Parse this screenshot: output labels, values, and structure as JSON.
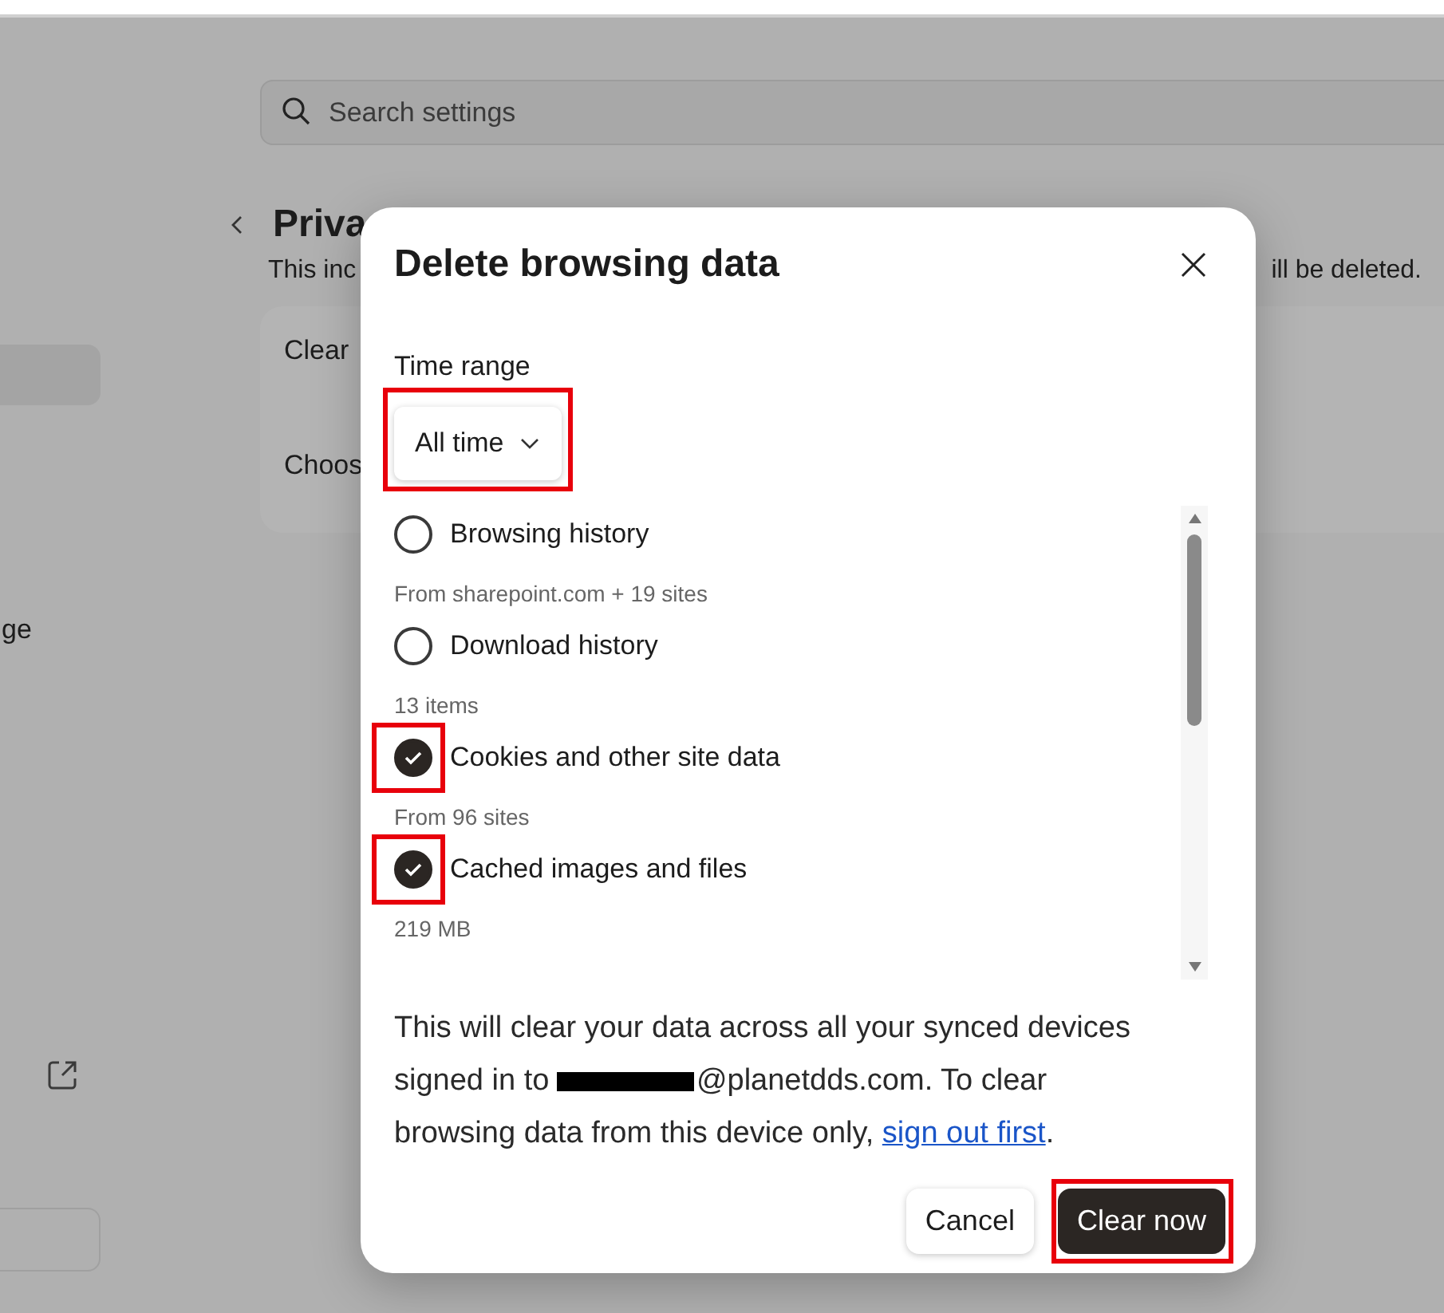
{
  "settings_page": {
    "search": {
      "placeholder": "Search settings"
    },
    "title": "Priva",
    "description": "This inc",
    "description_tail": "ill be deleted.",
    "card_rows": [
      "Clear",
      "Choos"
    ],
    "sidebar_items": [
      {
        "selected": true
      },
      {
        "label": "ge",
        "selected": false
      }
    ]
  },
  "dialog": {
    "title": "Delete browsing data",
    "time_range": {
      "label": "Time range",
      "value": "All time",
      "highlighted": true
    },
    "options": [
      {
        "label": "Browsing history",
        "detail": "From sharepoint.com + 19 sites",
        "checked": false,
        "highlighted": false
      },
      {
        "label": "Download history",
        "detail": "13 items",
        "checked": false,
        "highlighted": false
      },
      {
        "label": "Cookies and other site data",
        "detail": "From 96 sites",
        "checked": true,
        "highlighted": true
      },
      {
        "label": "Cached images and files",
        "detail": "219 MB",
        "checked": true,
        "highlighted": true
      }
    ],
    "notice": {
      "before": "This will clear your data across all your synced devices signed in to ",
      "redacted": true,
      "after": "@planetdds.com. To clear browsing data from this device only, ",
      "link": "sign out first",
      "end": "."
    },
    "buttons": [
      {
        "label": "Cancel",
        "kind": "secondary",
        "highlighted": false
      },
      {
        "label": "Clear now",
        "kind": "primary",
        "highlighted": true
      }
    ]
  }
}
